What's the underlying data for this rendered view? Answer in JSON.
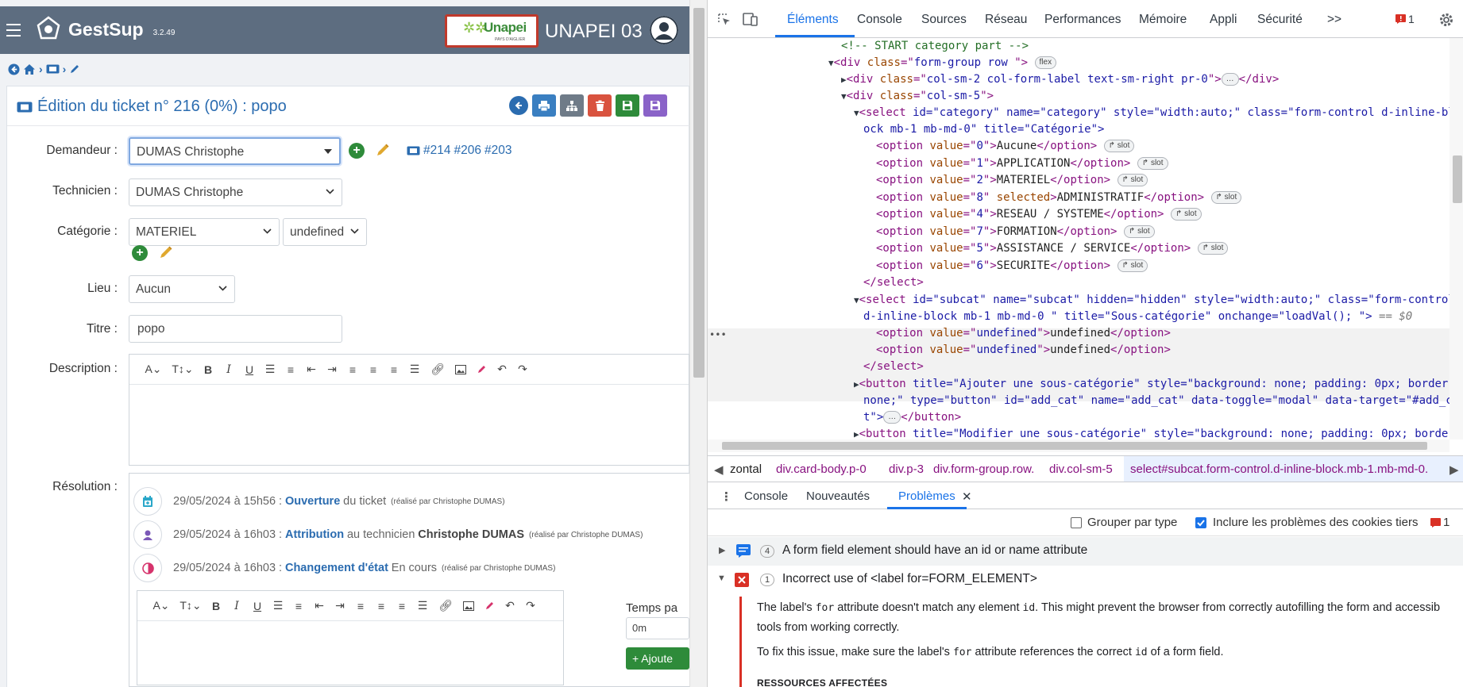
{
  "app": {
    "name": "GestSup",
    "version": "3.2.49",
    "org_logo_text": "Unapei",
    "org_logo_subtext": "PAYS D'AIGLIER",
    "org_name": "UNAPEI 03"
  },
  "ticket": {
    "title": "Édition du ticket n° 216 (0%) : popo",
    "requester_label": "Demandeur :",
    "requester_value": "DUMAS Christophe",
    "related_tickets": [
      "#214",
      "#206",
      "#203"
    ],
    "technician_label": "Technicien :",
    "technician_value": "DUMAS Christophe",
    "category_label": "Catégorie :",
    "category_value": "MATERIEL",
    "subcategory_value": "undefined",
    "location_label": "Lieu :",
    "location_value": "Aucun",
    "title_label": "Titre :",
    "title_value": "popo",
    "description_label": "Description :",
    "resolution_label": "Résolution :",
    "time_label": "Temps pa",
    "time_value": "0m",
    "add_button": "+ Ajoute"
  },
  "timeline": [
    {
      "date": "29/05/2024 à 15h56 :",
      "action": "Ouverture",
      "text": "du ticket",
      "who": "(réalisé par Christophe DUMAS)",
      "strong": ""
    },
    {
      "date": "29/05/2024 à 16h03 :",
      "action": "Attribution",
      "text": "au technicien",
      "who": "(réalisé par Christophe DUMAS)",
      "strong": "Christophe DUMAS"
    },
    {
      "date": "29/05/2024 à 16h03 :",
      "action": "Changement d'état",
      "text": "En cours",
      "who": "(réalisé par Christophe DUMAS)",
      "strong": ""
    }
  ],
  "devtools": {
    "tabs": [
      "Éléments",
      "Console",
      "Sources",
      "Réseau",
      "Performances",
      "Mémoire",
      "Appli",
      "Sécurité"
    ],
    "more": ">>",
    "issue_count": "1",
    "code": {
      "comment": "<!-- START category part -->",
      "l2_div_class": "form-group row ",
      "pill_flex": "flex",
      "l3_class": "col-sm-2 col-form-label text-sm-right pr-0",
      "l4_class": "col-sm-5",
      "select1_line1": "id=\"category\" name=\"category\" style=\"width:auto;\" class=\"form-control d-inline-bl",
      "select1_line2": "ock mb-1 mb-md-0\" title=\"Catégorie\">",
      "options": [
        {
          "value": "0",
          "label": "Aucune",
          "selected": false
        },
        {
          "value": "1",
          "label": "APPLICATION",
          "selected": false
        },
        {
          "value": "2",
          "label": "MATERIEL",
          "selected": false
        },
        {
          "value": "8",
          "label": "ADMINISTRATIF",
          "selected": true
        },
        {
          "value": "4",
          "label": "RESEAU / SYSTEME",
          "selected": false
        },
        {
          "value": "7",
          "label": "FORMATION",
          "selected": false
        },
        {
          "value": "5",
          "label": "ASSISTANCE / SERVICE",
          "selected": false
        },
        {
          "value": "6",
          "label": "SECURITE",
          "selected": false
        }
      ],
      "pill_slot": "slot",
      "select2_line1": "id=\"subcat\" name=\"subcat\" hidden=\"hidden\" style=\"width:auto;\" class=\"form-control",
      "select2_line2": "d-inline-block mb-1 mb-md-0 \" title=\"Sous-catégorie\" onchange=\"loadVal(); \">",
      "eq_dollar": "== $0",
      "sub_options": [
        "undefined",
        "undefined"
      ],
      "button1_line1": "title=\"Ajouter une sous-catégorie\" style=\"background: none; padding: 0px; border:",
      "button1_line2": "none;\" type=\"button\" id=\"add_cat\" name=\"add_cat\" data-toggle=\"modal\" data-target=\"#add_ca",
      "button1_line3": "t\">",
      "button2_line1": "title=\"Modifier une sous-catégorie\" style=\"background: none; padding: 0px; borde"
    },
    "breadcrumbs": [
      "zontal",
      "div.card-body.p-0",
      "div.p-3",
      "div.form-group.row.",
      "div.col-sm-5",
      "select#subcat.form-control.d-inline-block.mb-1.mb-md-0."
    ],
    "drawer_tabs": [
      "Console",
      "Nouveautés",
      "Problèmes"
    ],
    "group_by_type": "Grouper par type",
    "include_third_party": "Inclure les problèmes des cookies tiers",
    "filter_issue_count": "1",
    "issues": [
      {
        "count": "4",
        "title": "A form field element should have an id or name attribute"
      },
      {
        "count": "1",
        "title": "Incorrect use of <label for=FORM_ELEMENT>"
      }
    ],
    "issue_desc_1a": "The label's ",
    "issue_desc_1b": "for",
    "issue_desc_1c": " attribute doesn't match any element ",
    "issue_desc_1d": "id",
    "issue_desc_1e": ". This might prevent the browser from correctly autofilling the form and accessib",
    "issue_desc_2": "tools from working correctly.",
    "issue_fix_a": "To fix this issue, make sure the label's ",
    "issue_fix_b": "for",
    "issue_fix_c": " attribute references the correct ",
    "issue_fix_d": "id",
    "issue_fix_e": " of a form field.",
    "resources": "RESSOURCES AFFECTÉES"
  },
  "colors": {
    "header": "#5d6d80",
    "link": "#2b6cb0",
    "accent_devtools": "#1a73e8",
    "error": "#d93025"
  }
}
